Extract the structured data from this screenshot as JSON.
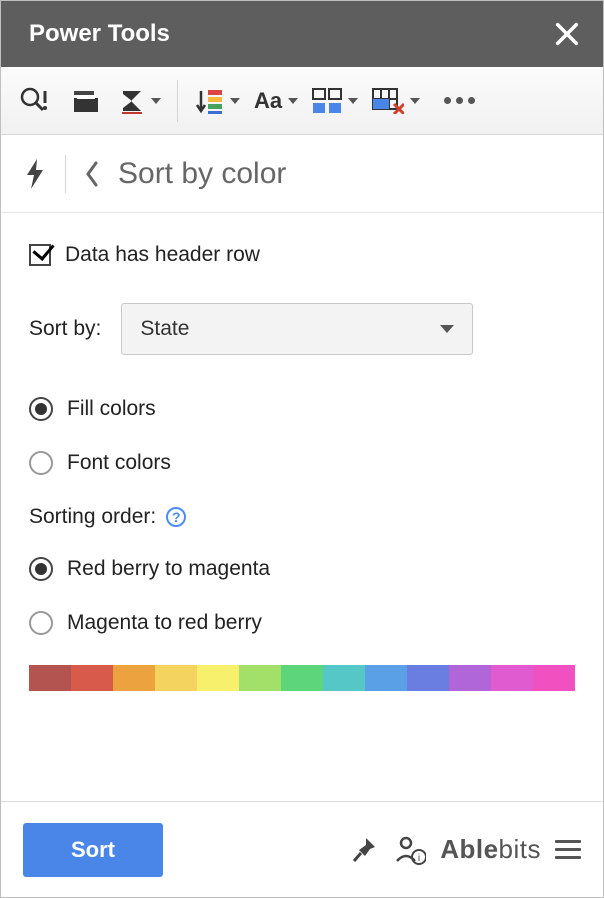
{
  "titlebar": {
    "title": "Power Tools"
  },
  "breadcrumb": {
    "title": "Sort by color"
  },
  "form": {
    "header_checkbox_label": "Data has header row",
    "header_checkbox_checked": true,
    "sort_by_label": "Sort by:",
    "sort_by_value": "State",
    "color_mode": {
      "fill_label": "Fill colors",
      "font_label": "Font colors",
      "selected": "fill"
    },
    "order_label": "Sorting order:",
    "order": {
      "rb_to_m_label": "Red berry to magenta",
      "m_to_rb_label": "Magenta to red berry",
      "selected": "rb_to_m"
    },
    "spectrum": [
      "#b45450",
      "#d75a4a",
      "#eba23f",
      "#f4d35e",
      "#f7f06d",
      "#a3e06a",
      "#5dd57a",
      "#56c7c7",
      "#5aa0e6",
      "#6a7de0",
      "#b065d8",
      "#e05bd0",
      "#f050c0"
    ]
  },
  "footer": {
    "sort_button": "Sort",
    "brand_bold": "Able",
    "brand_rest": "bits"
  }
}
